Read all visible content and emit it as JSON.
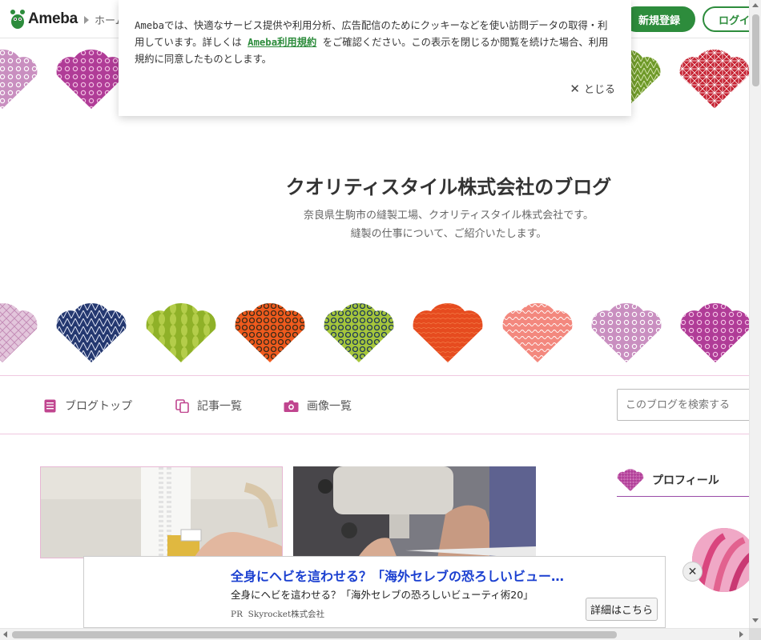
{
  "header": {
    "logo_text": "Ameba",
    "breadcrumb_home": "ホーム",
    "signup_label": "新規登録",
    "login_label": "ログイン"
  },
  "cookie_banner": {
    "text_before_link": "Amebaでは、快適なサービス提供や利用分析、広告配信のためにクッキーなどを使い訪問データの取得・利用しています。詳しくは ",
    "link_label": "Ameba利用規約",
    "text_after_link": " をご確認ください。この表示を閉じるか閲覧を続けた場合、利用規約に同意したものとします。",
    "close_label": "とじる"
  },
  "blog": {
    "title": "クオリティスタイル株式会社のブログ",
    "description_line1": "奈良県生駒市の縫製工場、クオリティスタイル株式会社です。",
    "description_line2": "縫製の仕事について、ご紹介いたします。"
  },
  "nav": {
    "items": [
      {
        "label": "ブログトップ",
        "icon": "document-icon"
      },
      {
        "label": "記事一覧",
        "icon": "copy-icon"
      },
      {
        "label": "画像一覧",
        "icon": "camera-icon"
      }
    ],
    "search_placeholder": "このブログを検索する"
  },
  "sidebar": {
    "profile_title": "プロフィール"
  },
  "ad": {
    "title": "全身にヘビを這わせる？「海外セレブの恐ろしいビュー…",
    "body": "全身にヘビを這わせる？「海外セレブの恐ろしいビューティ術20」",
    "pr_label": "PR",
    "advertiser": "Skyrocket株式会社",
    "detail_button": "詳細はこちら"
  },
  "colors": {
    "brand_green": "#2d8c3c",
    "nav_border_pink": "#f0c8e0",
    "accent_purple": "#9a4ba7",
    "ad_title_blue": "#1a3fd0"
  }
}
